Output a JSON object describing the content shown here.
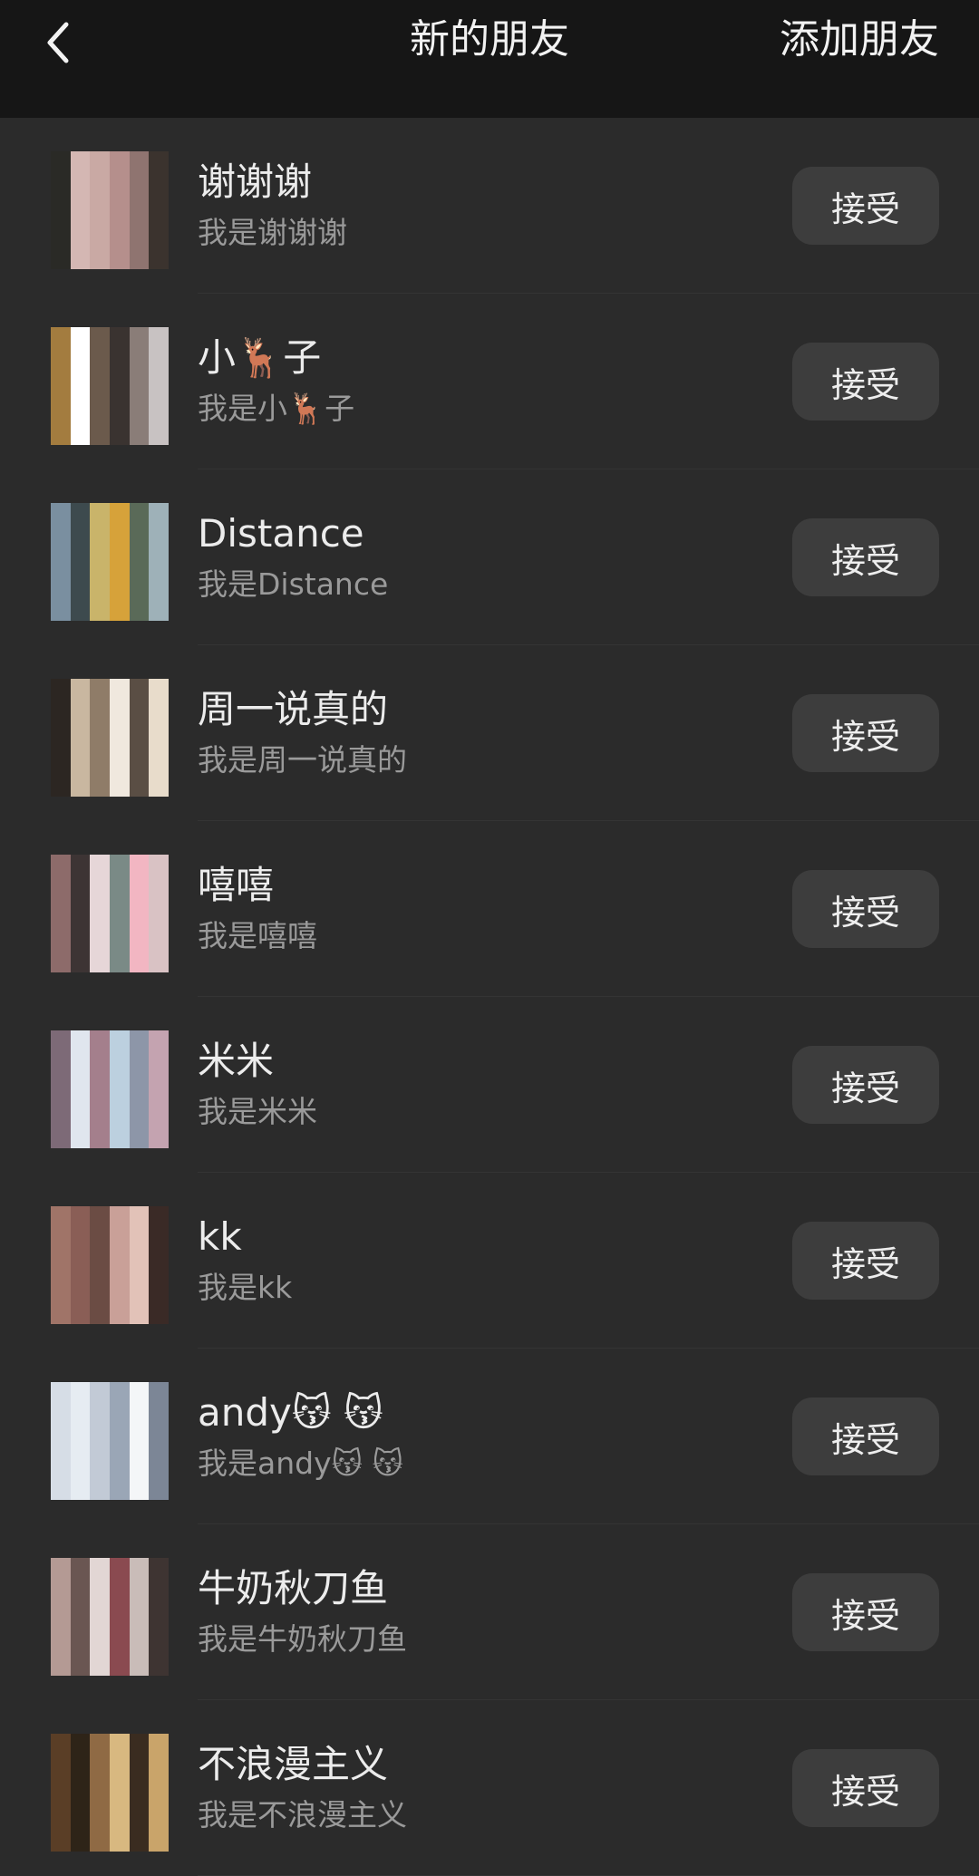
{
  "header": {
    "back_icon": "chevron-left-icon",
    "title": "新的朋友",
    "action_label": "添加朋友"
  },
  "requests": [
    {
      "name": "谢谢谢",
      "greeting": "我是谢谢谢",
      "action_label": "接受"
    },
    {
      "name": "小🦌子",
      "greeting": "我是小🦌子",
      "action_label": "接受"
    },
    {
      "name": "Distance",
      "greeting": "我是Distance",
      "action_label": "接受"
    },
    {
      "name": "周一说真的",
      "greeting": "我是周一说真的",
      "action_label": "接受"
    },
    {
      "name": "嘻嘻",
      "greeting": "我是嘻嘻",
      "action_label": "接受"
    },
    {
      "name": "米米",
      "greeting": "我是米米",
      "action_label": "接受"
    },
    {
      "name": "kk",
      "greeting": "我是kk",
      "action_label": "接受"
    },
    {
      "name": "andy😽 😽",
      "greeting": "我是andy😽 😽",
      "action_label": "接受"
    },
    {
      "name": "牛奶秋刀鱼",
      "greeting": "我是牛奶秋刀鱼",
      "action_label": "接受"
    },
    {
      "name": "不浪漫主义",
      "greeting": "我是不浪漫主义",
      "action_label": "接受"
    }
  ]
}
